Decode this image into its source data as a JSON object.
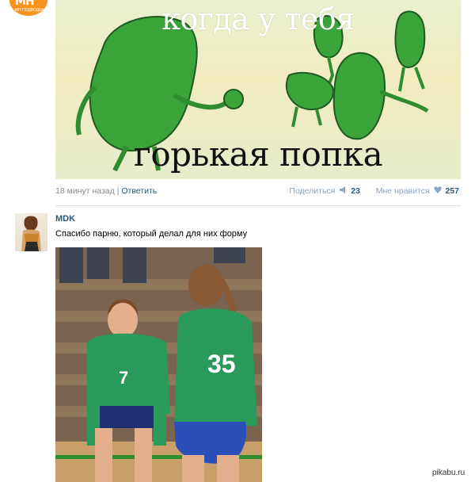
{
  "top_post": {
    "avatar_text": "MH",
    "avatar_sub": "MH ПОДВОДКА",
    "meme_caption_top": "когда у тебя",
    "meme_caption_bottom": "горькая попка",
    "time": "18 минут назад",
    "separator": "|",
    "reply_label": "Ответить",
    "share_label": "Поделиться",
    "share_count": "23",
    "like_label": "Мне нравится",
    "like_count": "257"
  },
  "second_post": {
    "author": "MDK",
    "text": "Спасибо парню, который делал для них форму",
    "jersey_left": "7",
    "jersey_right": "35"
  },
  "watermark": "pikabu.ru",
  "colors": {
    "link": "#2b587a",
    "meta": "#8a8a8a",
    "jersey_green": "#2a9a5a",
    "pickle_green": "#3aa43a"
  },
  "icons": [
    "megaphone-icon",
    "heart-icon"
  ]
}
